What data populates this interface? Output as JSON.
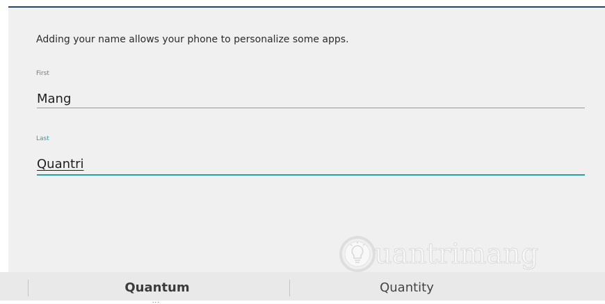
{
  "form": {
    "intro": "Adding your name allows your phone to personalize some apps.",
    "first": {
      "label": "First",
      "value": "Mang"
    },
    "last": {
      "label": "Last",
      "value": "Quantri"
    }
  },
  "suggestions": {
    "items": [
      "Quantum",
      "Quantity"
    ],
    "more_indicator": "..."
  },
  "watermark": {
    "text": "uantrimang"
  },
  "colors": {
    "panel_background": "#f0f0f0",
    "focus_accent": "#2a9fa8",
    "top_border": "#20486a",
    "suggestion_bar": "#e9e9e9"
  },
  "icons": {
    "watermark_logo": "lightbulb-icon"
  }
}
